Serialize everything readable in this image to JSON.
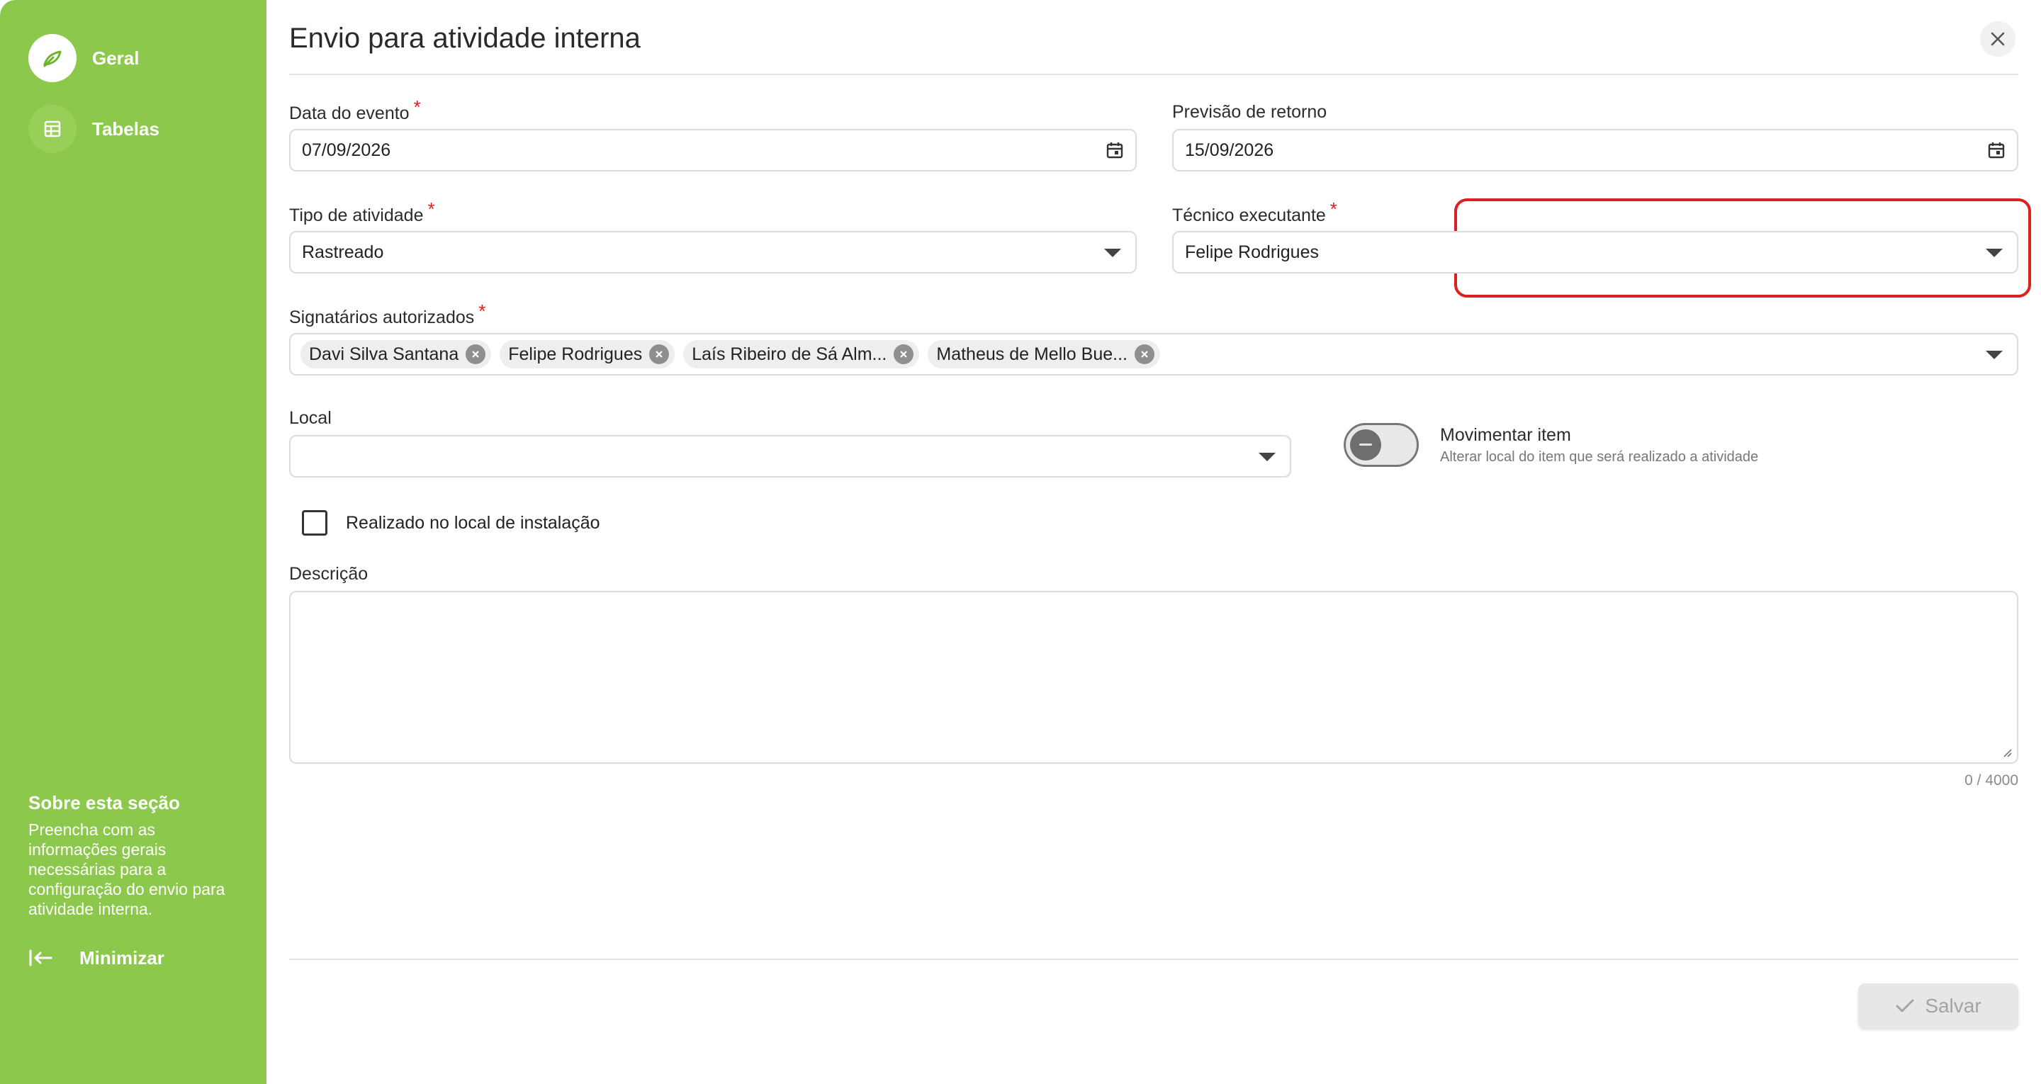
{
  "sidebar": {
    "items": [
      {
        "label": "Geral",
        "icon": "leaf-pencil-icon",
        "active": true
      },
      {
        "label": "Tabelas",
        "icon": "table-icon",
        "active": false
      }
    ],
    "about": {
      "title": "Sobre esta seção",
      "text": "Preencha com as informações gerais necessárias para a configuração do envio para atividade interna."
    },
    "minimize_label": "Minimizar"
  },
  "dialog": {
    "title": "Envio para atividade interna"
  },
  "form": {
    "event_date": {
      "label": "Data do evento",
      "value": "07/09/2026",
      "required": true
    },
    "return_date": {
      "label": "Previsão de retorno",
      "value": "15/09/2026"
    },
    "activity_type": {
      "label": "Tipo de atividade",
      "value": "Rastreado",
      "required": true
    },
    "technician": {
      "label": "Técnico executante",
      "value": "Felipe Rodrigues",
      "required": true
    },
    "signatories": {
      "label": "Signatários autorizados",
      "required": true,
      "chips": [
        "Davi Silva Santana",
        "Felipe Rodrigues",
        "Laís Ribeiro de Sá Alm...",
        "Matheus de Mello Bue..."
      ]
    },
    "local": {
      "label": "Local",
      "value": ""
    },
    "move_item": {
      "title": "Movimentar item",
      "subtitle": "Alterar local do item que será realizado a atividade",
      "enabled": false
    },
    "installed_location": {
      "label": "Realizado no local de instalação",
      "checked": false
    },
    "description": {
      "label": "Descrição",
      "value": "",
      "counter": "0 / 4000"
    }
  },
  "footer": {
    "save_label": "Salvar"
  },
  "colors": {
    "sidebar_bg": "#8cc84b",
    "required": "#e02020",
    "highlight": "#dd1f1f"
  }
}
